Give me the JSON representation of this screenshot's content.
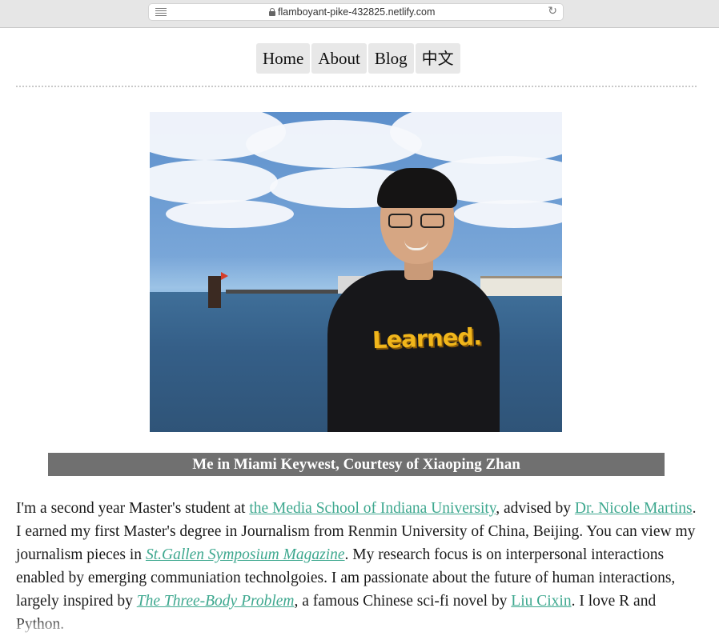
{
  "browser": {
    "url": "flamboyant-pike-432825.netlify.com"
  },
  "nav": {
    "items": [
      {
        "label": "Home"
      },
      {
        "label": "About"
      },
      {
        "label": "Blog"
      },
      {
        "label": "中文"
      }
    ]
  },
  "photo": {
    "shirt_text": "Learned."
  },
  "caption": "Me in Miami Keywest, Courtesy of Xiaoping Zhan",
  "bio": {
    "t1": "I'm a second year Master's student at ",
    "link_school": "the Media School of Indiana University",
    "t2": ", advised by ",
    "link_advisor": "Dr. Nicole Martins",
    "t3": ". I earned my first Master's degree in Journalism from Renmin University of China, Beijing. You can view my journalism pieces in ",
    "link_magazine": "St.Gallen Symposium Magazine",
    "t4": ". My research focus is on interpersonal interactions enabled by emerging communiation technolgoies. I am passionate about the future of human interactions, largely inspired by ",
    "link_book": "The Three-Body Problem",
    "t5": ", a famous Chinese sci-fi novel by ",
    "link_author": "Liu Cixin",
    "t6": ". I love R and Python."
  }
}
